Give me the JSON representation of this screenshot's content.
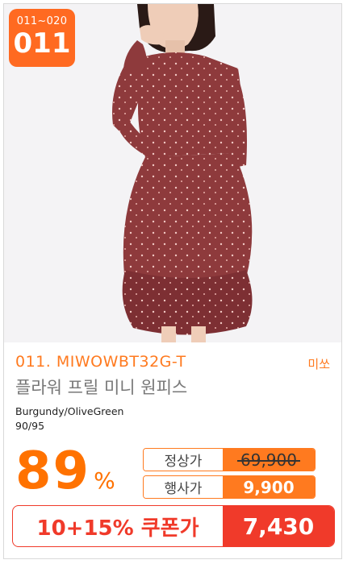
{
  "badge": {
    "range": "011~020",
    "number": "011"
  },
  "product": {
    "code": "011. MIWOWBT32G-T",
    "brand": "미쏘",
    "name": "플라워 프릴 미니 원피스",
    "color": "Burgundy/OliveGreen",
    "size": "90/95"
  },
  "discount": {
    "percent": "89",
    "symbol": "%"
  },
  "prices": {
    "regular_label": "정상가",
    "regular_value": "69,900",
    "event_label": "행사가",
    "event_value": "9,900"
  },
  "coupon": {
    "label": "10+15% 쿠폰가",
    "value": "7,430"
  },
  "colors": {
    "accent": "#ff7a1f",
    "coupon": "#f03a2a",
    "dress": "#8e3a3c"
  },
  "icons": {
    "product_image": "model-wearing-burgundy-floral-dress"
  }
}
